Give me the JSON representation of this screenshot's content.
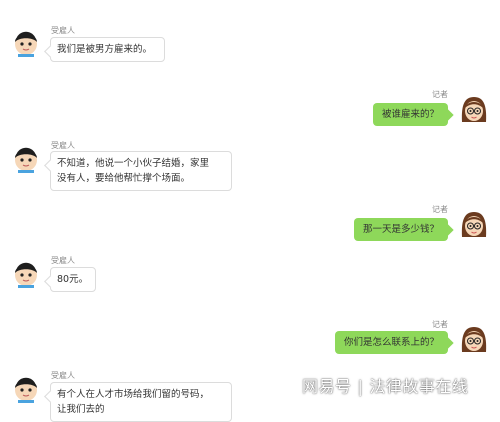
{
  "messages": [
    {
      "sender": "受雇人",
      "side": "left",
      "text": "我们是被男方雇来的。"
    },
    {
      "sender": "记者",
      "side": "right",
      "text": "被谁雇来的？"
    },
    {
      "sender": "受雇人",
      "side": "left",
      "lines": [
        "不知道，他说一个小伙子结婚，家里",
        "没有人，要给他帮忙撑个场面。"
      ]
    },
    {
      "sender": "记者",
      "side": "right",
      "text": "那一天是多少钱？"
    },
    {
      "sender": "受雇人",
      "side": "left",
      "text": "80元。"
    },
    {
      "sender": "记者",
      "side": "right",
      "text": "你们是怎么联系上的？"
    },
    {
      "sender": "受雇人",
      "side": "left",
      "lines": [
        "有个人在人才市场给我们留的号码，",
        "让我们去的"
      ]
    }
  ],
  "watermark": {
    "brand": "网易号",
    "separator": "|",
    "channel": "法律故事在线"
  },
  "colors": {
    "right_bubble": "#8ed85a",
    "left_bubble_border": "#dcdcdc",
    "name_text": "#8a8a8a"
  },
  "icons": {
    "left_avatar": "boy-avatar-icon",
    "right_avatar": "girl-avatar-icon"
  }
}
